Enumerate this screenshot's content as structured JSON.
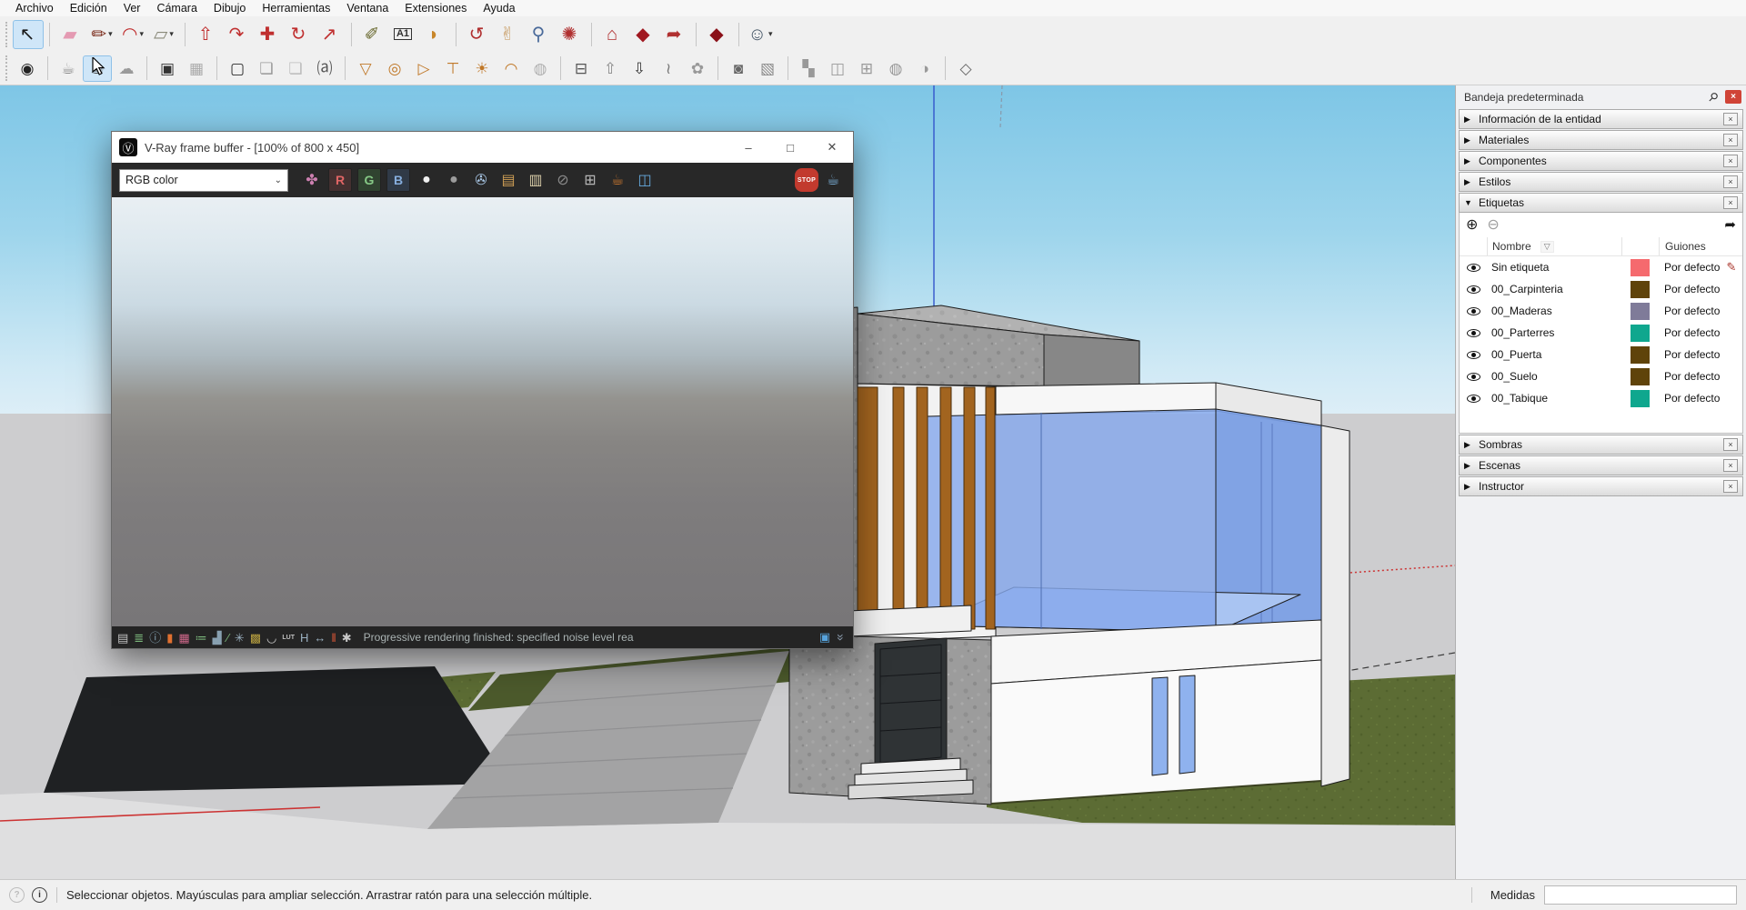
{
  "menu": {
    "items": [
      "Archivo",
      "Edición",
      "Ver",
      "Cámara",
      "Dibujo",
      "Herramientas",
      "Ventana",
      "Extensiones",
      "Ayuda"
    ]
  },
  "toolbar_row1": {
    "items": [
      {
        "name": "select-tool",
        "glyph": "↖",
        "color": "#1a1a1a",
        "caret": "",
        "cls": "active"
      },
      {
        "name": "toolbar-separator",
        "glyph": "",
        "caret": "",
        "cls": "sep"
      },
      {
        "name": "eraser-tool",
        "glyph": "▰",
        "color": "#e49ab2",
        "caret": ""
      },
      {
        "name": "line-tool",
        "glyph": "✏",
        "color": "#7a2a1a",
        "caret": "▾"
      },
      {
        "name": "arc-tool",
        "glyph": "◠",
        "color": "#c03030",
        "caret": "▾"
      },
      {
        "name": "rectangle-tool",
        "glyph": "▱",
        "color": "#8a8a7a",
        "caret": "▾"
      },
      {
        "name": "toolbar-separator",
        "glyph": "",
        "caret": "",
        "cls": "sep"
      },
      {
        "name": "push-pull-tool",
        "glyph": "⇧",
        "color": "#c03030",
        "caret": ""
      },
      {
        "name": "offset-tool",
        "glyph": "↷",
        "color": "#c03030",
        "caret": ""
      },
      {
        "name": "move-tool",
        "glyph": "✚",
        "color": "#c03030",
        "caret": ""
      },
      {
        "name": "rotate-tool",
        "glyph": "↻",
        "color": "#c03030",
        "caret": ""
      },
      {
        "name": "scale-tool",
        "glyph": "↗",
        "color": "#c03030",
        "caret": ""
      },
      {
        "name": "toolbar-separator",
        "glyph": "",
        "caret": "",
        "cls": "sep"
      },
      {
        "name": "tape-measure-tool",
        "glyph": "✐",
        "color": "#6a6a30",
        "caret": ""
      },
      {
        "name": "text-tool",
        "glyph": "A1",
        "color": "#333333",
        "caret": "",
        "cls": "txt"
      },
      {
        "name": "paint-bucket-tool",
        "glyph": "◗",
        "color": "#c8862a",
        "caret": ""
      },
      {
        "name": "toolbar-separator",
        "glyph": "",
        "caret": "",
        "cls": "sep"
      },
      {
        "name": "orbit-tool",
        "glyph": "↺",
        "color": "#b03030",
        "caret": ""
      },
      {
        "name": "pan-tool",
        "glyph": "✌",
        "color": "#caa06a",
        "caret": ""
      },
      {
        "name": "zoom-tool",
        "glyph": "⚲",
        "color": "#4a6a9a",
        "caret": ""
      },
      {
        "name": "zoom-extents-tool",
        "glyph": "✺",
        "color": "#b03030",
        "caret": ""
      },
      {
        "name": "toolbar-separator",
        "glyph": "",
        "caret": "",
        "cls": "sep"
      },
      {
        "name": "3d-warehouse-button",
        "glyph": "⌂",
        "color": "#b03030",
        "caret": ""
      },
      {
        "name": "extension-warehouse-button",
        "glyph": "◆",
        "color": "#a01820",
        "caret": ""
      },
      {
        "name": "share-model-button",
        "glyph": "➦",
        "color": "#b03030",
        "caret": ""
      },
      {
        "name": "toolbar-separator",
        "glyph": "",
        "caret": "",
        "cls": "sep"
      },
      {
        "name": "extension-manager-button",
        "glyph": "◆",
        "color": "#8a1018",
        "caret": ""
      },
      {
        "name": "toolbar-separator",
        "glyph": "",
        "caret": "",
        "cls": "sep"
      },
      {
        "name": "account-button",
        "glyph": "☺",
        "color": "#445566",
        "caret": "▾"
      }
    ]
  },
  "toolbar_row2": {
    "items": [
      {
        "name": "vray-asset-editor-button",
        "glyph": "◉",
        "color": "#222222",
        "cls": ""
      },
      {
        "name": "toolbar-separator",
        "glyph": "",
        "cls": "sep"
      },
      {
        "name": "vray-render-button",
        "glyph": "☕",
        "color": "#8a8a8a",
        "cls": ""
      },
      {
        "name": "vray-render-interactive-button",
        "glyph": "☕",
        "color": "#4a4a4a",
        "cls": "active"
      },
      {
        "name": "vray-render-cloud-button",
        "glyph": "☁",
        "color": "#9a9a9a",
        "cls": ""
      },
      {
        "name": "toolbar-separator",
        "glyph": "",
        "cls": "sep"
      },
      {
        "name": "vray-viewport-render-button",
        "glyph": "▣",
        "color": "#333333",
        "cls": ""
      },
      {
        "name": "vray-viewport-render-region-button",
        "glyph": "▦",
        "color": "#aaaaaa",
        "cls": ""
      },
      {
        "name": "toolbar-separator",
        "glyph": "",
        "cls": "sep"
      },
      {
        "name": "vray-frame-buffer-button",
        "glyph": "▢",
        "color": "#2a2a2a",
        "cls": ""
      },
      {
        "name": "vray-batch-render-button",
        "glyph": "❏",
        "color": "#999999",
        "cls": ""
      },
      {
        "name": "vray-render-history-button",
        "glyph": "❏",
        "color": "#bbbbbb",
        "cls": ""
      },
      {
        "name": "vray-lock-camera-button",
        "glyph": "⒜",
        "color": "#555555",
        "cls": ""
      },
      {
        "name": "toolbar-separator",
        "glyph": "",
        "cls": "sep"
      },
      {
        "name": "vray-rect-light-button",
        "glyph": "▽",
        "color": "#c07828",
        "cls": ""
      },
      {
        "name": "vray-sphere-light-button",
        "glyph": "◎",
        "color": "#c07828",
        "cls": ""
      },
      {
        "name": "vray-spot-light-button",
        "glyph": "▷",
        "color": "#c07828",
        "cls": ""
      },
      {
        "name": "vray-ies-light-button",
        "glyph": "⊤",
        "color": "#c07828",
        "cls": ""
      },
      {
        "name": "vray-omni-light-button",
        "glyph": "☀",
        "color": "#c07828",
        "cls": ""
      },
      {
        "name": "vray-dome-light-button",
        "glyph": "◠",
        "color": "#c07828",
        "cls": ""
      },
      {
        "name": "vray-mesh-light-button",
        "glyph": "◍",
        "color": "#b0b0b0",
        "cls": ""
      },
      {
        "name": "toolbar-separator",
        "glyph": "",
        "cls": "sep"
      },
      {
        "name": "vray-infinite-plane-button",
        "glyph": "⊟",
        "color": "#555555",
        "cls": ""
      },
      {
        "name": "vray-export-proxy-button",
        "glyph": "⇧",
        "color": "#888888",
        "cls": ""
      },
      {
        "name": "vray-import-proxy-button",
        "glyph": "⇩",
        "color": "#333333",
        "cls": ""
      },
      {
        "name": "vray-fur-button",
        "glyph": "≀",
        "color": "#777777",
        "cls": ""
      },
      {
        "name": "vray-clipper-button",
        "glyph": "✿",
        "color": "#999999",
        "cls": ""
      },
      {
        "name": "toolbar-separator",
        "glyph": "",
        "cls": "sep"
      },
      {
        "name": "vray-denoiser-button",
        "glyph": "◙",
        "color": "#666666",
        "cls": ""
      },
      {
        "name": "vray-lightgen-button",
        "glyph": "▧",
        "color": "#888888",
        "cls": ""
      },
      {
        "name": "toolbar-separator",
        "glyph": "",
        "cls": "sep"
      },
      {
        "name": "vray-uvw-planar-button",
        "glyph": "▚",
        "color": "#999999",
        "cls": ""
      },
      {
        "name": "vray-uvw-box-button",
        "glyph": "◫",
        "color": "#999999",
        "cls": ""
      },
      {
        "name": "vray-uvw-tri-planar-button",
        "glyph": "⊞",
        "color": "#999999",
        "cls": ""
      },
      {
        "name": "vray-uvw-spherical-button",
        "glyph": "◍",
        "color": "#999999",
        "cls": ""
      },
      {
        "name": "vray-uvw-cylindrical-button",
        "glyph": "◑",
        "color": "#999999",
        "cls": ""
      },
      {
        "name": "toolbar-separator",
        "glyph": "",
        "cls": "sep"
      },
      {
        "name": "vray-scene-interaction-button",
        "glyph": "◇",
        "color": "#666666",
        "cls": ""
      }
    ]
  },
  "vfb": {
    "title": "V-Ray frame buffer - [100% of 800 x 450]",
    "logo_glyph": "Ⓥ",
    "controls": {
      "minimize": "–",
      "maximize": "□",
      "close": "✕"
    },
    "channel": "RGB color",
    "select_caret": "⌄",
    "toolbar_icons": [
      {
        "name": "vfb-color-corrections-icon",
        "glyph": "✤",
        "color": "#cc7fb0",
        "cls": ""
      },
      {
        "name": "vfb-red-channel-button",
        "glyph": "R",
        "color": "#e06565",
        "cls": "chan chanR"
      },
      {
        "name": "vfb-green-channel-button",
        "glyph": "G",
        "color": "#86c986",
        "cls": "chan chanG"
      },
      {
        "name": "vfb-blue-channel-button",
        "glyph": "B",
        "color": "#86aede",
        "cls": "chan chanB"
      },
      {
        "name": "vfb-white-channel-button",
        "glyph": "●",
        "color": "#f0f0f0",
        "cls": ""
      },
      {
        "name": "vfb-alpha-channel-button",
        "glyph": "●",
        "color": "#9c9c9c",
        "cls": ""
      },
      {
        "name": "vfb-save-image-button",
        "glyph": "✇",
        "color": "#a8c6e4",
        "cls": ""
      },
      {
        "name": "vfb-open-image-button",
        "glyph": "▤",
        "color": "#cf9f55",
        "cls": ""
      },
      {
        "name": "vfb-copy-clipboard-button",
        "glyph": "▥",
        "color": "#d9cda8",
        "cls": ""
      },
      {
        "name": "vfb-clear-image-button",
        "glyph": "⊘",
        "color": "#8a8a8a",
        "cls": ""
      },
      {
        "name": "vfb-pixel-info-button",
        "glyph": "⊞",
        "color": "#b8b8b8",
        "cls": ""
      },
      {
        "name": "vfb-render-last-button",
        "glyph": "☕",
        "color": "#cf7a30",
        "cls": ""
      },
      {
        "name": "vfb-ab-compare-button",
        "glyph": "◫",
        "color": "#66aade",
        "cls": ""
      },
      {
        "name": "vfb-stop-render-button",
        "glyph": "STOP",
        "color": "#ffffff",
        "cls": "stop"
      },
      {
        "name": "vfb-start-render-button",
        "glyph": "☕",
        "color": "#7fb7e2",
        "cls": ""
      }
    ],
    "bottom_icons": [
      {
        "name": "vfb-panel-toggle-icon",
        "glyph": "▤",
        "color": "#c0c0c0",
        "cls": ""
      },
      {
        "name": "vfb-layers-icon",
        "glyph": "≣",
        "color": "#7cb87c",
        "cls": ""
      },
      {
        "name": "vfb-info-icon",
        "glyph": "ⓘ",
        "color": "#8aaabb",
        "cls": ""
      },
      {
        "name": "vfb-exposure-icon",
        "glyph": "▮",
        "color": "#e07030",
        "cls": ""
      },
      {
        "name": "vfb-hsl-icon",
        "glyph": "▦",
        "color": "#cc6688",
        "cls": ""
      },
      {
        "name": "vfb-color-balance-icon",
        "glyph": "≔",
        "color": "#7cb87c",
        "cls": ""
      },
      {
        "name": "vfb-histogram-icon",
        "glyph": "▟",
        "color": "#88a0b0",
        "cls": ""
      },
      {
        "name": "vfb-curves-icon",
        "glyph": "∕",
        "color": "#7cb87c",
        "cls": ""
      },
      {
        "name": "vfb-aperture-icon",
        "glyph": "✳",
        "color": "#9ab0c0",
        "cls": ""
      },
      {
        "name": "vfb-background-icon",
        "glyph": "▩",
        "color": "#b8a040",
        "cls": ""
      },
      {
        "name": "vfb-curve-editor-icon",
        "glyph": "◡",
        "color": "#d0d0d0",
        "cls": ""
      },
      {
        "name": "vfb-lut-icon",
        "glyph": "LUT",
        "color": "#c0c0c0",
        "cls": "small"
      },
      {
        "name": "vfb-heatmap-icon",
        "glyph": "H",
        "color": "#9ab0c0",
        "cls": ""
      },
      {
        "name": "vfb-heat-range-icon",
        "glyph": "↔",
        "color": "#9ab0c0",
        "cls": ""
      },
      {
        "name": "vfb-stereo-icon",
        "glyph": "‖",
        "color": "#e05838",
        "cls": ""
      },
      {
        "name": "vfb-sharpen-icon",
        "glyph": "✱",
        "color": "#c8c8c8",
        "cls": ""
      }
    ],
    "status_message": "Progressive rendering finished: specified noise level rea",
    "monitor_glyph": "▣",
    "chevron_glyph": "»"
  },
  "tray": {
    "title": "Bandeja predeterminada",
    "pin_glyph": "⚲",
    "close_glyph": "×",
    "sections_top": [
      {
        "name": "section-entity-info",
        "label": "Información de la entidad",
        "arrow": "▶"
      },
      {
        "name": "section-materials",
        "label": "Materiales",
        "arrow": "▶"
      },
      {
        "name": "section-components",
        "label": "Componentes",
        "arrow": "▶"
      },
      {
        "name": "section-styles",
        "label": "Estilos",
        "arrow": "▶"
      }
    ],
    "etiquetas": {
      "label": "Etiquetas",
      "arrow": "▼",
      "add_glyph": "⊕",
      "remove_glyph": "⊖",
      "details_glyph": "➦",
      "header_name": "Nombre",
      "sort_glyph": "▽",
      "header_dashes": "Guiones",
      "rows": [
        {
          "name": "Sin etiqueta",
          "color": "#f56a6e",
          "dashes": "Por defecto",
          "pencil": "✎"
        },
        {
          "name": "00_Carpinteria",
          "color": "#5f430a",
          "dashes": "Por defecto",
          "pencil": ""
        },
        {
          "name": "00_Maderas",
          "color": "#7f7b99",
          "dashes": "Por defecto",
          "pencil": ""
        },
        {
          "name": "00_Parterres",
          "color": "#0fa78e",
          "dashes": "Por defecto",
          "pencil": ""
        },
        {
          "name": "00_Puerta",
          "color": "#5f430a",
          "dashes": "Por defecto",
          "pencil": ""
        },
        {
          "name": "00_Suelo",
          "color": "#5f430a",
          "dashes": "Por defecto",
          "pencil": ""
        },
        {
          "name": "00_Tabique",
          "color": "#0fa78e",
          "dashes": "Por defecto",
          "pencil": ""
        }
      ]
    },
    "sections_bottom": [
      {
        "name": "section-shadows",
        "label": "Sombras",
        "arrow": "▶"
      },
      {
        "name": "section-scenes",
        "label": "Escenas",
        "arrow": "▶"
      },
      {
        "name": "section-instructor",
        "label": "Instructor",
        "arrow": "▶"
      }
    ]
  },
  "statusbar": {
    "help_glyph": "?",
    "info_glyph": "i",
    "message": "Seleccionar objetos. Mayúsculas para ampliar selección. Arrastrar ratón para una selección múltiple.",
    "measures_label": "Medidas"
  },
  "viewport_colors": {
    "sky_top": "#7ec6e6",
    "sky_horizon": "#ddeef7",
    "backdrop": "#cdcdcf",
    "lawn": "#5c6c34",
    "hedge": "#4c5a2c",
    "asphalt": "#1f2123",
    "road": "#a3a3a4",
    "concrete": "#9c9c9c",
    "wood_slats": "#a2641f",
    "glass": "#86a8ec",
    "axis_blue": "#3355cc",
    "axis_red": "#cc3333",
    "active_highlight": "#cfe6f8"
  }
}
